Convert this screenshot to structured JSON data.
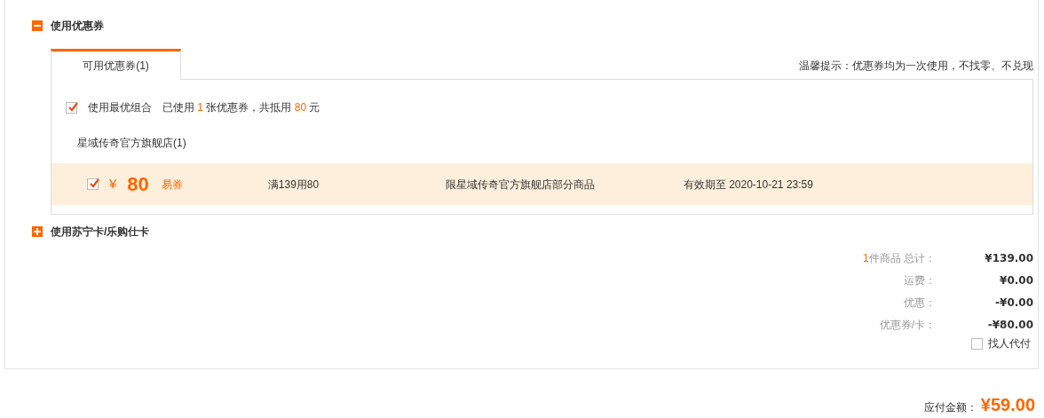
{
  "coupon_section": {
    "title": "使用优惠券",
    "expanded": true,
    "tabs": [
      {
        "label": "可用优惠券(1)",
        "selected": true
      }
    ],
    "notice": "温馨提示：优惠券均为一次使用，不找零、不兑现",
    "best_combo": {
      "checked": true,
      "label": "使用最优组合",
      "parts": [
        {
          "text": "已使用 ",
          "highlight": false
        },
        {
          "text": "1",
          "highlight": true
        },
        {
          "text": " 张优惠券，共抵用 ",
          "highlight": false
        },
        {
          "text": "80",
          "highlight": true
        },
        {
          "text": " 元",
          "highlight": false
        }
      ]
    },
    "store": "星域传奇官方旗舰店(1)",
    "coupons": [
      {
        "checked": true,
        "currency": "¥",
        "amount": "80",
        "type": "易券",
        "condition": "满139用80",
        "scope": "限星域传奇官方旗舰店部分商品",
        "validity": "有效期至 2020-10-21 23:59"
      }
    ]
  },
  "card_section": {
    "title": "使用苏宁卡/乐购仕卡",
    "expanded": false
  },
  "summary": [
    {
      "count": "1",
      "label": "件商品 总计：",
      "value": "¥139.00"
    },
    {
      "label": "运费：",
      "value": "¥0.00"
    },
    {
      "label": "优惠：",
      "value": "-¥0.00"
    },
    {
      "label": "优惠券/卡：",
      "value": "-¥80.00"
    }
  ],
  "pay_for_me": {
    "label": "找人代付",
    "checked": false
  },
  "total": {
    "label": "应付金额：",
    "value": "¥59.00"
  }
}
